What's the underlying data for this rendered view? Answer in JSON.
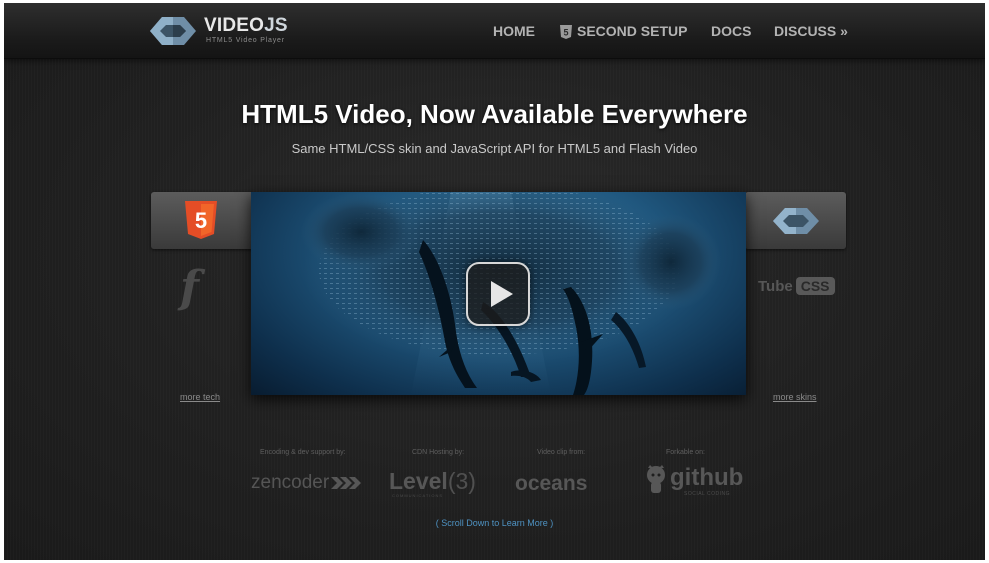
{
  "header": {
    "logo_text_bold": "VIDEO",
    "logo_text_js": "JS",
    "logo_tagline": "HTML5 Video Player",
    "nav": [
      {
        "label": "HOME"
      },
      {
        "label": "SECOND SETUP",
        "icon": "html5-shield-icon"
      },
      {
        "label": "DOCS"
      },
      {
        "label": "DISCUSS »"
      }
    ]
  },
  "hero": {
    "title": "HTML5 Video, Now Available Everywhere",
    "subtitle": "Same HTML/CSS skin and JavaScript API for HTML5 and Flash Video"
  },
  "tech": {
    "html5_badge": "5",
    "flash_glyph": "f",
    "more_link": "more tech"
  },
  "skins": {
    "tube": "Tube",
    "css": "CSS",
    "more_link": "more skins"
  },
  "video": {
    "play_icon": "play-icon"
  },
  "sponsors": {
    "encoding": {
      "caption": "Encoding & dev support by:",
      "logo": "zencoder"
    },
    "cdn": {
      "caption": "CDN Hosting by:",
      "logo_main": "Level",
      "logo_num": "(3)",
      "logo_sub": "COMMUNICATIONS"
    },
    "clip": {
      "caption": "Video clip from:",
      "logo": "oceans"
    },
    "fork": {
      "caption": "Forkable on:",
      "logo": "github",
      "logo_sub": "SOCIAL CODING"
    }
  },
  "scroll_link": "( Scroll Down to Learn More )",
  "colors": {
    "background": "#1d1d1d",
    "nav_text": "#b3b3b3",
    "html5_orange": "#e44d26",
    "link_blue": "#4e92c2"
  }
}
